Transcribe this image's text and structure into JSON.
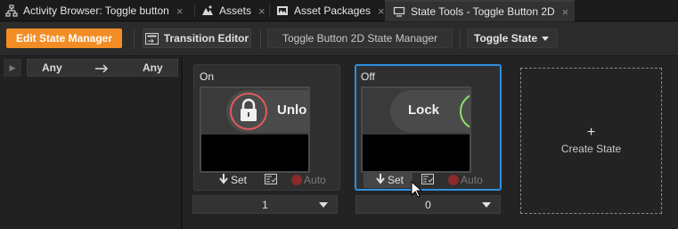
{
  "tabs": [
    {
      "label": "Activity Browser: Toggle button",
      "icon": "activity-browser-icon",
      "closable": true,
      "active": false
    },
    {
      "label": "Assets",
      "icon": "assets-icon",
      "closable": true,
      "active": false
    },
    {
      "label": "Asset Packages",
      "icon": "asset-packages-icon",
      "closable": true,
      "active": false
    },
    {
      "label": "State Tools - Toggle Button 2D",
      "icon": "state-tools-icon",
      "closable": true,
      "active": true
    }
  ],
  "close_glyph": "×",
  "toolbar": {
    "edit_state_manager": "Edit State Manager",
    "transition_editor": "Transition Editor",
    "state_manager_name": "Toggle Button 2D State Manager",
    "state_group": "Toggle State"
  },
  "transition": {
    "from": "Any",
    "to": "Any"
  },
  "states": [
    {
      "title": "On",
      "button_text": "Unlo",
      "icon": "lock-icon",
      "set_label": "Set",
      "auto_label": "Auto",
      "value": "1",
      "selected": false
    },
    {
      "title": "Off",
      "button_text": "Lock",
      "icon": "unlock-icon",
      "set_label": "Set",
      "auto_label": "Auto",
      "value": "0",
      "selected": true
    }
  ],
  "create_state": {
    "plus": "+",
    "label": "Create State"
  },
  "colors": {
    "accent_orange": "#f28d25",
    "selection_blue": "#2f8ee0",
    "on_ring_red": "#e05a5a",
    "off_ring_green": "#8ee06a",
    "auto_dot": "#8a2a2a"
  }
}
